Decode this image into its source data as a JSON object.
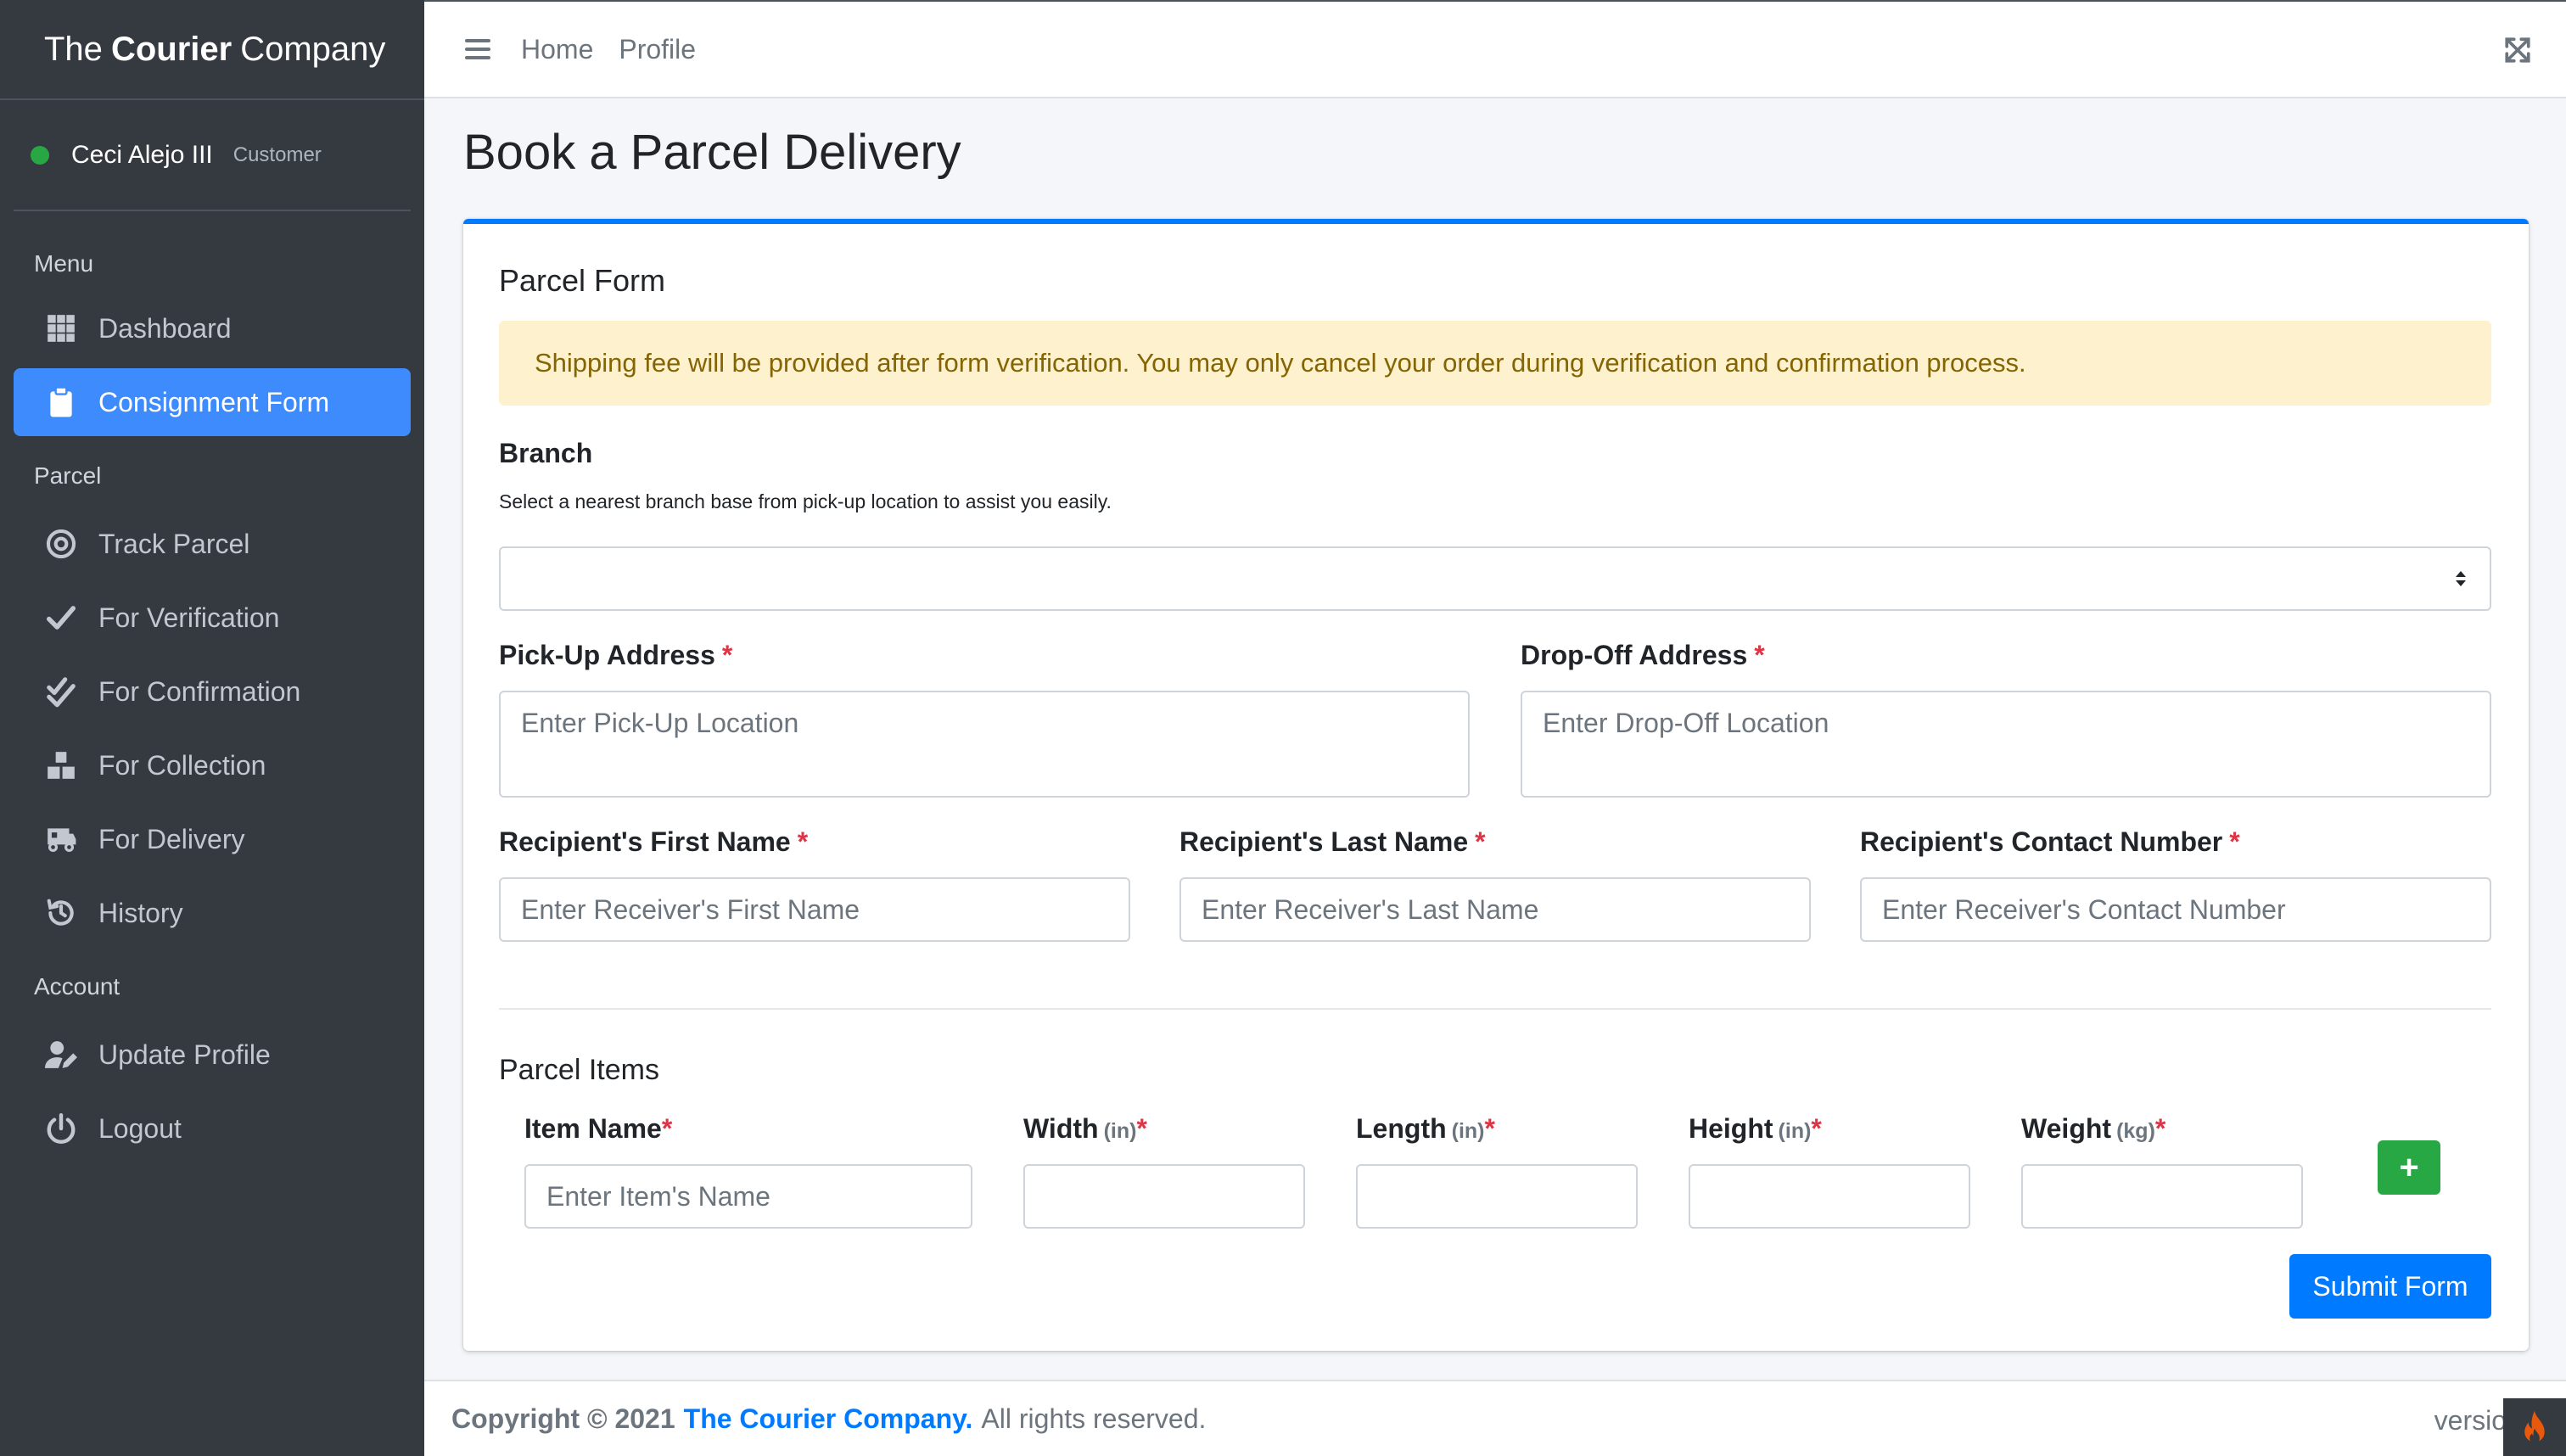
{
  "brand": {
    "part1": "The",
    "part2": "Courier",
    "part3": "Company"
  },
  "user": {
    "name": "Ceci Alejo III",
    "role": "Customer"
  },
  "sidebar": {
    "sections": [
      {
        "header": "Menu"
      },
      {
        "header": "Parcel"
      },
      {
        "header": "Account"
      }
    ],
    "items": [
      {
        "label": "Dashboard",
        "icon": "grid-icon"
      },
      {
        "label": "Consignment Form",
        "icon": "clipboard-icon",
        "active": true
      },
      {
        "label": "Track Parcel",
        "icon": "target-icon"
      },
      {
        "label": "For Verification",
        "icon": "check-icon"
      },
      {
        "label": "For Confirmation",
        "icon": "double-check-icon"
      },
      {
        "label": "For Collection",
        "icon": "boxes-icon"
      },
      {
        "label": "For Delivery",
        "icon": "truck-icon"
      },
      {
        "label": "History",
        "icon": "history-icon"
      },
      {
        "label": "Update Profile",
        "icon": "user-edit-icon"
      },
      {
        "label": "Logout",
        "icon": "power-icon"
      }
    ]
  },
  "topbar": {
    "home": "Home",
    "profile": "Profile"
  },
  "page": {
    "title": "Book a Parcel Delivery"
  },
  "form": {
    "card_title": "Parcel Form",
    "alert": "Shipping fee will be provided after form verification. You may only cancel your order during verification and confirmation process.",
    "branch": {
      "label": "Branch",
      "help": "Select a nearest branch base from pick-up location to assist you easily.",
      "value": ""
    },
    "pickup": {
      "label": "Pick-Up Address",
      "placeholder": "Enter Pick-Up Location"
    },
    "dropoff": {
      "label": "Drop-Off Address",
      "placeholder": "Enter Drop-Off Location"
    },
    "first_name": {
      "label": "Recipient's First Name",
      "placeholder": "Enter Receiver's First Name"
    },
    "last_name": {
      "label": "Recipient's Last Name",
      "placeholder": "Enter Receiver's Last Name"
    },
    "contact": {
      "label": "Recipient's Contact Number",
      "placeholder": "Enter Receiver's Contact Number"
    },
    "required_mark": "*",
    "items_section": "Parcel Items",
    "item_name": {
      "label": "Item Name",
      "placeholder": "Enter Item's Name"
    },
    "width": {
      "label": "Width",
      "unit": "(in)"
    },
    "length": {
      "label": "Length",
      "unit": "(in)"
    },
    "height": {
      "label": "Height",
      "unit": "(in)"
    },
    "weight": {
      "label": "Weight",
      "unit": "(kg)"
    },
    "add_label": "+",
    "submit_label": "Submit Form"
  },
  "footer": {
    "copyright": "Copyright © 2021",
    "brand": "The Courier Company.",
    "rights": "All rights reserved.",
    "version": "versio"
  },
  "colors": {
    "primary": "#007bff",
    "success": "#28a745",
    "sidebar": "#343a40",
    "alert_bg": "#fdf2cd",
    "alert_text": "#856404",
    "required": "#dc3545"
  }
}
